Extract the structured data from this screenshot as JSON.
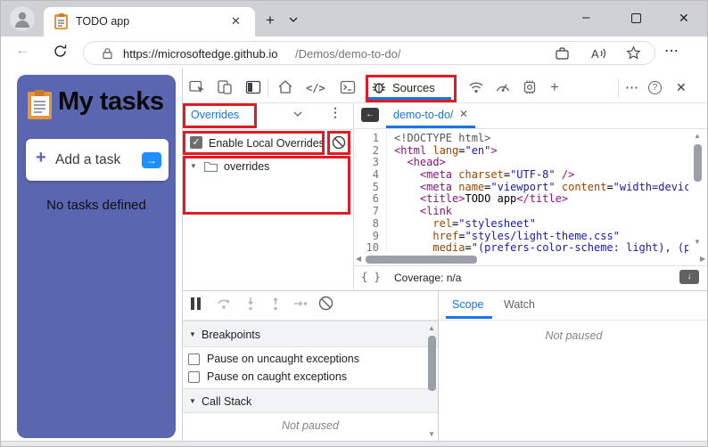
{
  "colors": {
    "annotation_red": "#e01b24",
    "accent_blue": "#1a73e8",
    "card_blue": "#5a66b0",
    "arrow_button_blue": "#1e8fff",
    "code_tag": "#881280",
    "code_attr": "#994500",
    "code_string": "#1a1aa6",
    "code_meta": "#555555"
  },
  "browser": {
    "tab_title": "TODO app",
    "url_host": "https://microsoftedge.github.io",
    "url_path": "/Demos/demo-to-do/"
  },
  "todo_app": {
    "title": "My tasks",
    "add_button": "Add a task",
    "empty_state": "No tasks defined"
  },
  "devtools": {
    "sources_tab": "Sources",
    "navigator": {
      "dropdown": "Overrides",
      "enable_overrides": "Enable Local Overrides",
      "folder": "overrides"
    },
    "editor": {
      "file_tab": "demo-to-do/",
      "coverage": "Coverage: n/a",
      "pretty_print": "{ }",
      "code_lines": [
        [
          {
            "c": "meta",
            "s": "<!DOCTYPE html>"
          }
        ],
        [
          {
            "c": "tag",
            "s": "<html"
          },
          {
            "c": "attr",
            "s": " lang"
          },
          {
            "c": "plain",
            "s": "="
          },
          {
            "c": "str",
            "s": "\"en\""
          },
          {
            "c": "tag",
            "s": ">"
          }
        ],
        [
          {
            "c": "plain",
            "s": "  "
          },
          {
            "c": "tag",
            "s": "<head>"
          }
        ],
        [
          {
            "c": "plain",
            "s": "    "
          },
          {
            "c": "tag",
            "s": "<meta"
          },
          {
            "c": "attr",
            "s": " charset"
          },
          {
            "c": "plain",
            "s": "="
          },
          {
            "c": "str",
            "s": "\"UTF-8\""
          },
          {
            "c": "tag",
            "s": " />"
          }
        ],
        [
          {
            "c": "plain",
            "s": "    "
          },
          {
            "c": "tag",
            "s": "<meta"
          },
          {
            "c": "attr",
            "s": " name"
          },
          {
            "c": "plain",
            "s": "="
          },
          {
            "c": "str",
            "s": "\"viewport\""
          },
          {
            "c": "attr",
            "s": " content"
          },
          {
            "c": "plain",
            "s": "="
          },
          {
            "c": "str",
            "s": "\"width=device-"
          }
        ],
        [
          {
            "c": "plain",
            "s": "    "
          },
          {
            "c": "tag",
            "s": "<title>"
          },
          {
            "c": "plain",
            "s": "TODO app"
          },
          {
            "c": "tag",
            "s": "</title>"
          }
        ],
        [
          {
            "c": "plain",
            "s": "    "
          },
          {
            "c": "tag",
            "s": "<link"
          }
        ],
        [
          {
            "c": "plain",
            "s": "      "
          },
          {
            "c": "attr",
            "s": "rel"
          },
          {
            "c": "plain",
            "s": "="
          },
          {
            "c": "str",
            "s": "\"stylesheet\""
          }
        ],
        [
          {
            "c": "plain",
            "s": "      "
          },
          {
            "c": "attr",
            "s": "href"
          },
          {
            "c": "plain",
            "s": "="
          },
          {
            "c": "str",
            "s": "\"styles/light-theme.css\""
          }
        ],
        [
          {
            "c": "plain",
            "s": "      "
          },
          {
            "c": "attr",
            "s": "media"
          },
          {
            "c": "plain",
            "s": "="
          },
          {
            "c": "str",
            "s": "\"(prefers-color-scheme: light), (pre"
          }
        ]
      ]
    },
    "debugger": {
      "breakpoints": "Breakpoints",
      "pause_uncaught": "Pause on uncaught exceptions",
      "pause_caught": "Pause on caught exceptions",
      "call_stack": "Call Stack",
      "call_stack_status": "Not paused",
      "scope_tab": "Scope",
      "watch_tab": "Watch",
      "scope_status": "Not paused"
    }
  }
}
